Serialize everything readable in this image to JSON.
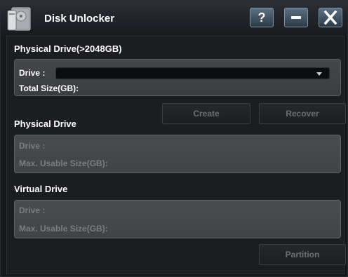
{
  "app": {
    "title": "Disk Unlocker"
  },
  "titlebar": {
    "help_label": "?",
    "min_icon": "minimize-icon",
    "close_icon": "close-icon"
  },
  "physical_large": {
    "title": "Physical Drive(>2048GB)",
    "drive_label": "Drive :",
    "drive_value": "",
    "total_size_label": "Total Size(GB):"
  },
  "actions": {
    "create_label": "Create",
    "recover_label": "Recover"
  },
  "physical": {
    "title": "Physical Drive",
    "drive_label": "Drive :",
    "max_size_label": "Max. Usable Size(GB):"
  },
  "virtual": {
    "title": "Virtual Drive",
    "drive_label": "Drive :",
    "max_size_label": "Max. Usable Size(GB):"
  },
  "footer": {
    "partition_label": "Partition"
  }
}
